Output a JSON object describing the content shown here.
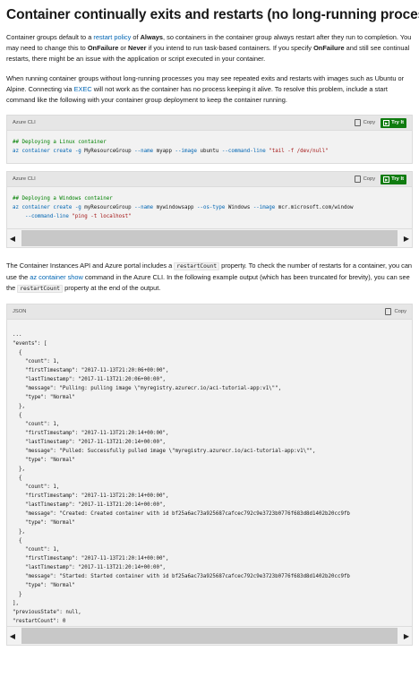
{
  "page": {
    "title": "Container continually exits and restarts (no long-running process)",
    "p1": {
      "t1": "Container groups default to a ",
      "link1": "restart policy",
      "t2": " of ",
      "b1": "Always",
      "t3": ", so containers in the container group always restart after they run to completion. You may need to change this to ",
      "b2": "OnFailure",
      "t4": " or ",
      "b3": "Never",
      "t5": " if you intend to run task-based containers. If you specify ",
      "b4": "OnFailure",
      "t6": " and still see continual restarts, there might be an issue with the application or script executed in your container."
    },
    "p2": {
      "t1": "When running container groups without long-running processes you may see repeated exits and restarts with images such as Ubuntu or Alpine. Connecting via ",
      "link1": "EXEC",
      "t2": " will not work as the container has no process keeping it alive. To resolve this problem, include a start command like the following with your container group deployment to keep the container running."
    },
    "p3": {
      "t1": "The Container Instances API and Azure portal includes a ",
      "code1": "restartCount",
      "t2": " property. To check the number of restarts for a container, you can use the ",
      "link1": "az container show",
      "t2b": " command in the Azure CLI. In the following example output (which has been truncated for brevity), you can see the ",
      "code2": "restartCount",
      "t3": " property at the end of the output."
    }
  },
  "code_blocks": {
    "copy_label": "Copy",
    "tryit_label": "Try It",
    "linux": {
      "lang": "Azure CLI",
      "comment": "## Deploying a Linux container",
      "cmd": "az container create",
      "flag1": "-g",
      "arg1": " MyResourceGroup ",
      "flag2": "--name",
      "arg2": " myapp ",
      "flag3": "--image",
      "arg3": " ubuntu ",
      "flag4": "--command-line",
      "arg4": " \"tail -f /dev/null\""
    },
    "windows": {
      "lang": "Azure CLI",
      "comment": "## Deploying a Windows container",
      "cmd": "az container create",
      "flag1": "-g",
      "arg1": " myResourceGroup ",
      "flag2": "--name",
      "arg2": " mywindowsapp ",
      "flag3": "--os-type",
      "arg3": " Windows ",
      "flag4": "--image",
      "arg4": " mcr.microsoft.com/window",
      "flag5": "    --command-line",
      "arg5": " \"ping -t localhost\""
    },
    "json": {
      "lang": "JSON",
      "lines": [
        "...",
        "\"events\": [",
        "  {",
        "    \"count\": 1,",
        "    \"firstTimestamp\": \"2017-11-13T21:20:06+00:00\",",
        "    \"lastTimestamp\": \"2017-11-13T21:20:06+00:00\",",
        "    \"message\": \"Pulling: pulling image \\\"myregistry.azurecr.io/aci-tutorial-app:v1\\\"\",",
        "    \"type\": \"Normal\"",
        "  },",
        "  {",
        "    \"count\": 1,",
        "    \"firstTimestamp\": \"2017-11-13T21:20:14+00:00\",",
        "    \"lastTimestamp\": \"2017-11-13T21:20:14+00:00\",",
        "    \"message\": \"Pulled: Successfully pulled image \\\"myregistry.azurecr.io/aci-tutorial-app:v1\\\"\",",
        "    \"type\": \"Normal\"",
        "  },",
        "  {",
        "    \"count\": 1,",
        "    \"firstTimestamp\": \"2017-11-13T21:20:14+00:00\",",
        "    \"lastTimestamp\": \"2017-11-13T21:20:14+00:00\",",
        "    \"message\": \"Created: Created container with id bf25a6ac73a925687cafcec792c9e3723b0776f683d8d1402b20cc9fb",
        "    \"type\": \"Normal\"",
        "  },",
        "  {",
        "    \"count\": 1,",
        "    \"firstTimestamp\": \"2017-11-13T21:20:14+00:00\",",
        "    \"lastTimestamp\": \"2017-11-13T21:20:14+00:00\",",
        "    \"message\": \"Started: Started container with id bf25a6ac73a925687cafcec792c9e3723b0776f683d8d1402b20cc9fb",
        "    \"type\": \"Normal\"",
        "  }",
        "],",
        "\"previousState\": null,",
        "\"restartCount\": 0",
        "...",
        "}"
      ]
    }
  },
  "colors": {
    "link": "#0065b3",
    "tryit_bg": "#107c10",
    "code_bg": "#f2f2f2",
    "header_bg": "#e6e6e6",
    "comment": "#008000",
    "string": "#a31515"
  },
  "icons": [
    "copy-icon",
    "tryit-icon",
    "scroll-left-icon",
    "scroll-right-icon"
  ]
}
